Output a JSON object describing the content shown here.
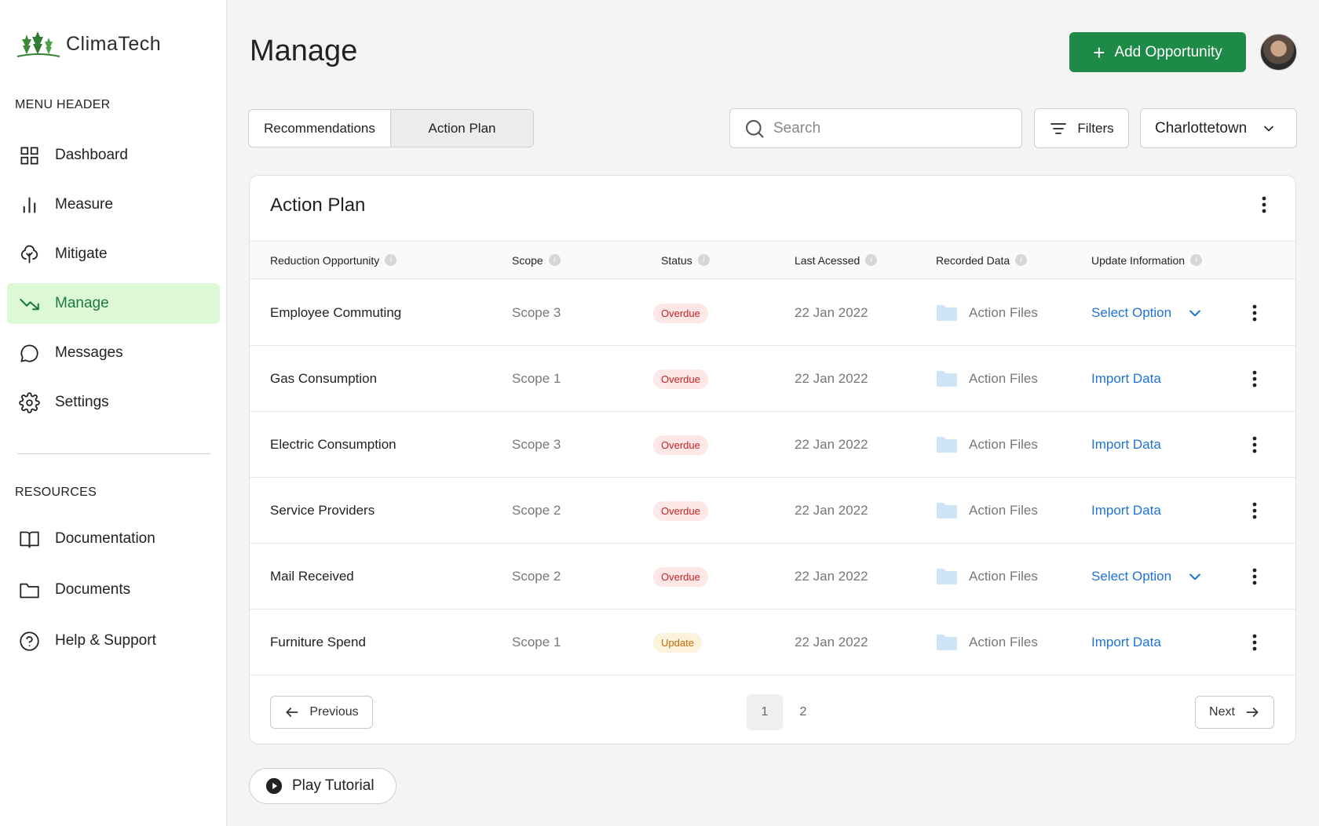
{
  "brand": {
    "name": "ClimaTech"
  },
  "sidebar": {
    "menu_header": "MENU HEADER",
    "items": [
      {
        "label": "Dashboard",
        "icon": "grid-icon"
      },
      {
        "label": "Measure",
        "icon": "bar-chart-icon"
      },
      {
        "label": "Mitigate",
        "icon": "tree-icon"
      },
      {
        "label": "Manage",
        "icon": "trend-down-icon",
        "active": true
      },
      {
        "label": "Messages",
        "icon": "chat-icon"
      },
      {
        "label": "Settings",
        "icon": "gear-icon"
      }
    ],
    "resources_header": "RESOURCES",
    "resources": [
      {
        "label": "Documentation",
        "icon": "book-icon"
      },
      {
        "label": "Documents",
        "icon": "folder-icon"
      },
      {
        "label": "Help & Support",
        "icon": "help-icon"
      }
    ]
  },
  "header": {
    "title": "Manage",
    "add_button": "Add Opportunity"
  },
  "tabs": [
    "Recommendations",
    "Action Plan"
  ],
  "search": {
    "placeholder": "Search"
  },
  "filters_label": "Filters",
  "location": "Charlottetown",
  "card": {
    "title": "Action Plan",
    "columns": [
      "Reduction Opportunity",
      "Scope",
      "Status",
      "Last Acessed",
      "Recorded Data",
      "Update Information"
    ],
    "rows": [
      {
        "name": "Employee Commuting",
        "scope": "Scope 3",
        "status": "Overdue",
        "status_type": "overdue",
        "date": "22 Jan 2022",
        "files": "Action Files",
        "update": "Select Option",
        "dropdown": true
      },
      {
        "name": "Gas Consumption",
        "scope": "Scope 1",
        "status": "Overdue",
        "status_type": "overdue",
        "date": "22 Jan 2022",
        "files": "Action Files",
        "update": "Import Data",
        "dropdown": false
      },
      {
        "name": "Electric Consumption",
        "scope": "Scope 3",
        "status": "Overdue",
        "status_type": "overdue",
        "date": "22 Jan 2022",
        "files": "Action Files",
        "update": "Import Data",
        "dropdown": false
      },
      {
        "name": "Service Providers",
        "scope": "Scope 2",
        "status": "Overdue",
        "status_type": "overdue",
        "date": "22 Jan 2022",
        "files": "Action Files",
        "update": "Import Data",
        "dropdown": false
      },
      {
        "name": "Mail Received",
        "scope": "Scope 2",
        "status": "Overdue",
        "status_type": "overdue",
        "date": "22 Jan 2022",
        "files": "Action Files",
        "update": "Select Option",
        "dropdown": true
      },
      {
        "name": "Furniture Spend",
        "scope": "Scope 1",
        "status": "Update",
        "status_type": "update",
        "date": "22 Jan 2022",
        "files": "Action Files",
        "update": "Import Data",
        "dropdown": false
      }
    ]
  },
  "pagination": {
    "previous": "Previous",
    "next": "Next",
    "pages": [
      "1",
      "2"
    ],
    "current": "1"
  },
  "tutorial": "Play Tutorial",
  "colors": {
    "accent": "#1e8a48",
    "active_bg": "#dcf8d4",
    "link": "#1f73d1",
    "overdue": "#c82121",
    "update": "#c26a07"
  }
}
